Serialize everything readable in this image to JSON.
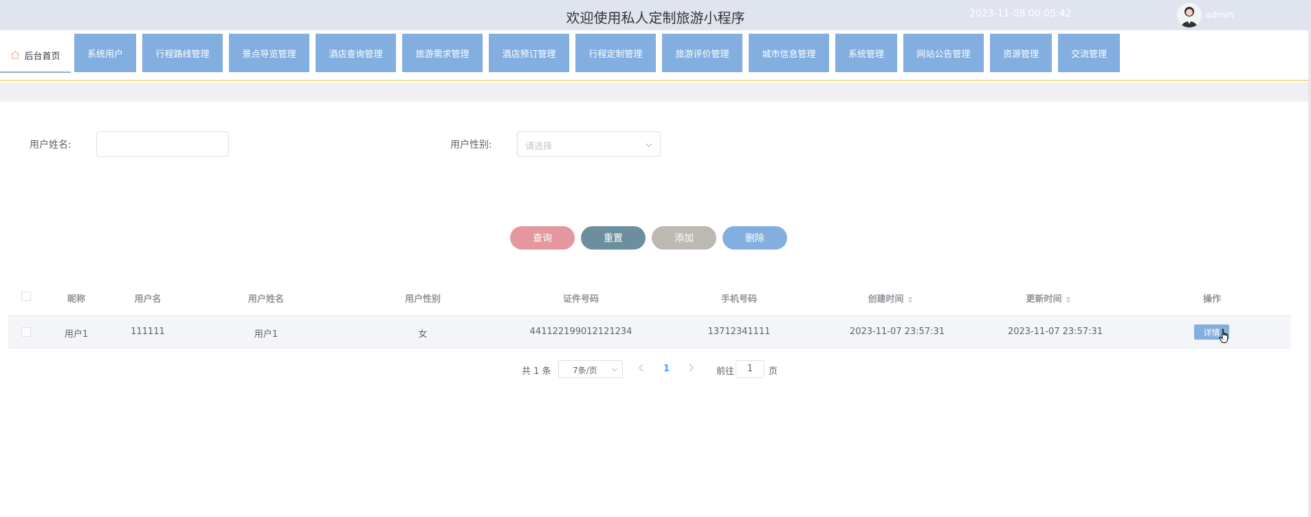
{
  "header": {
    "title": "欢迎使用私人定制旅游小程序",
    "datetime": "2023-11-08 00:05:42",
    "username": "admin"
  },
  "nav": {
    "home_label": "后台首页",
    "items": [
      "系统用户",
      "行程路线管理",
      "景点导览管理",
      "酒店查询管理",
      "旅游需求管理",
      "酒店预订管理",
      "行程定制管理",
      "旅游评价管理",
      "城市信息管理",
      "系统管理",
      "网站公告管理",
      "资源管理",
      "交流管理"
    ]
  },
  "search": {
    "name_label": "用户姓名:",
    "name_value": "",
    "gender_label": "用户性别:",
    "gender_placeholder": "请选择"
  },
  "actions": {
    "query": "查询",
    "reset": "重置",
    "add": "添加",
    "delete": "删除"
  },
  "colors": {
    "query": "#e4979e",
    "reset": "#6b8f9e",
    "add": "#bcb8b2",
    "delete": "#83aee0",
    "nav": "#83aee0"
  },
  "table": {
    "columns": [
      "昵称",
      "用户名",
      "用户姓名",
      "用户性别",
      "证件号码",
      "手机号码",
      "创建时间",
      "更新时间",
      "操作"
    ],
    "rows": [
      {
        "nickname": "用户1",
        "username": "111111",
        "realname": "用户1",
        "gender": "女",
        "id_number": "441122199012121234",
        "phone": "13712341111",
        "created": "2023-11-07 23:57:31",
        "updated": "2023-11-07 23:57:31",
        "action": "详情"
      }
    ]
  },
  "pagination": {
    "total": "共 1 条",
    "page_size": "7条/页",
    "current_page": "1",
    "goto_label": "前往",
    "goto_value": "1",
    "page_suffix": "页"
  }
}
